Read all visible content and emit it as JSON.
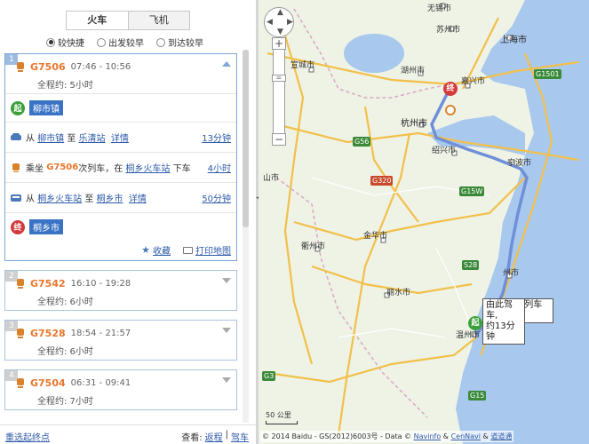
{
  "tabs": [
    {
      "label": "火车",
      "active": true
    },
    {
      "label": "飞机",
      "active": false
    }
  ],
  "sort_options": [
    {
      "label": "较快捷",
      "checked": true
    },
    {
      "label": "出发较早",
      "checked": false
    },
    {
      "label": "到达较早",
      "checked": false
    }
  ],
  "results": [
    {
      "num": "1",
      "train": "G7506",
      "time": "07:46 - 10:56",
      "duration": "全程约: 5小时",
      "expanded": true,
      "start_station": "柳市镇",
      "steps": [
        {
          "type": "car",
          "from_prefix": "从",
          "from": "柳市镇",
          "mid": "至",
          "to": "乐清站",
          "detail": "详情",
          "time": "13分钟"
        },
        {
          "type": "train",
          "prefix": "乘坐",
          "train": "G7506",
          "mid": "次列车，在",
          "station": "桐乡火车站",
          "suffix": "下车",
          "time": "4小时"
        },
        {
          "type": "bus",
          "from_prefix": "从",
          "from": "桐乡火车站",
          "mid": "至",
          "to": "桐乡市",
          "detail": "详情",
          "time": "50分钟"
        }
      ],
      "end_station": "桐乡市",
      "actions": {
        "collect": "收藏",
        "print": "打印地图"
      }
    },
    {
      "num": "2",
      "train": "G7542",
      "time": "16:10 - 19:28",
      "duration": "全程约: 6小时",
      "expanded": false
    },
    {
      "num": "3",
      "train": "G7528",
      "time": "18:54 - 21:57",
      "duration": "全程约: 6小时",
      "expanded": false
    },
    {
      "num": "4",
      "train": "G7504",
      "time": "06:31 - 09:41",
      "duration": "全程约: 7小时",
      "expanded": false
    }
  ],
  "footer": {
    "reset": "重选起终点",
    "view": "查看:",
    "return": "返程",
    "sep": "|",
    "drive": "驾车"
  },
  "map": {
    "labels": {
      "wuxi": "无锡市",
      "suzhou": "苏州市",
      "shanghai": "上海市",
      "xuancheng": "宣城市",
      "huzhou": "湖州市",
      "jiaxing": "嘉兴市",
      "hangzhou": "杭州市",
      "shaoxing": "绍兴市",
      "ningbo": "宁波市",
      "jinhua": "金华市",
      "quzhou": "衢州市",
      "lishui": "丽水市",
      "taizhou": "台州市",
      "wenzhou": "温州市",
      "city_a": "山市",
      "city_b": "州市"
    },
    "shields": [
      "G1501",
      "G56",
      "G320",
      "G15W",
      "S28",
      "G3",
      "G15"
    ],
    "start_pin": "起",
    "end_pin": "终",
    "bubble_drive": [
      "由此驾车,",
      "约13分钟"
    ],
    "bubble_train": [
      "G7506次列车",
      "约4小时"
    ],
    "scale": "50 公里",
    "zoom_in": "+",
    "zoom_out": "−",
    "copyright": {
      "text": "© 2014 Baidu - GS(2012)6003号 - Data ©",
      "navinfo": "Navinfo",
      "amp": "&",
      "cennavi": "CenNavi",
      "amp2": "&",
      "daodao": "道道通"
    },
    "colors": {
      "route": "#6f8fd8",
      "highway": "#f2c04a",
      "water": "#a9c8ee",
      "land": "#eef3e6"
    }
  }
}
